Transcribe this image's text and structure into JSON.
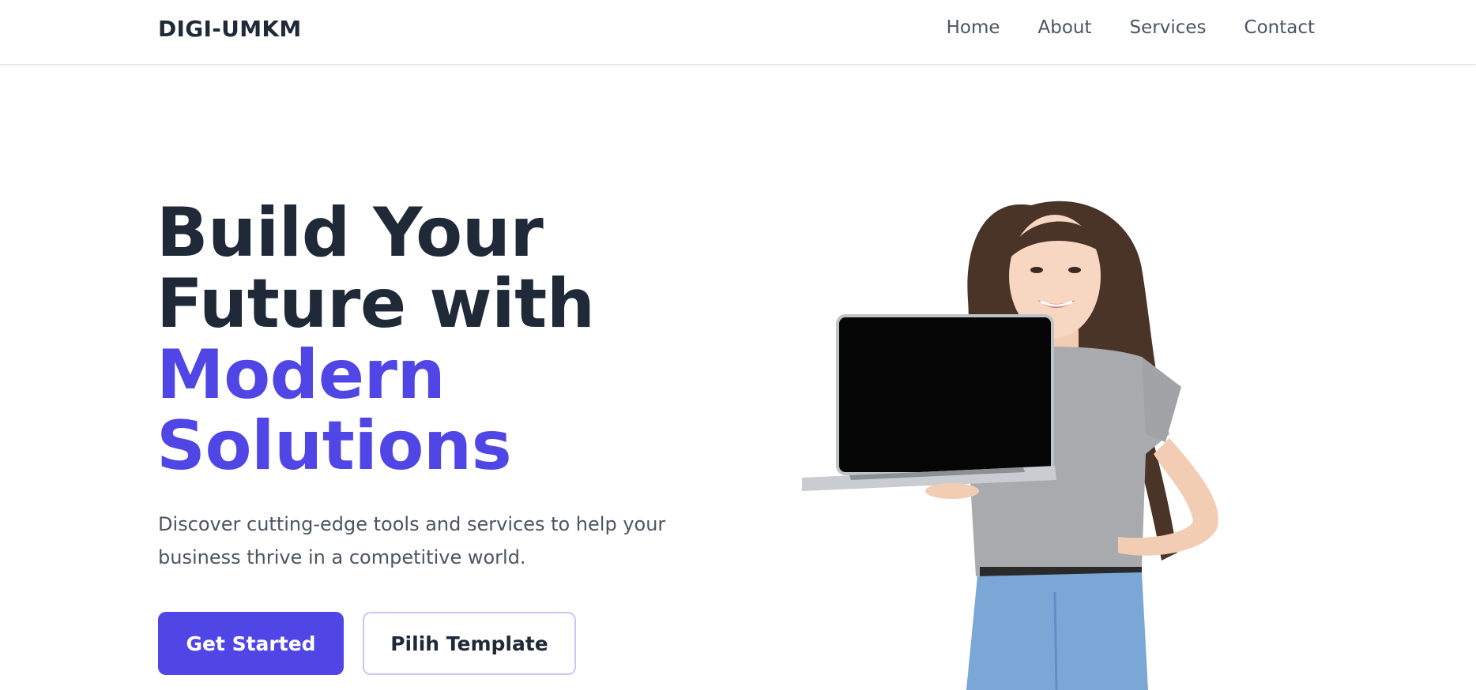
{
  "nav": {
    "brand": "DIGI-UMKM",
    "links": [
      "Home",
      "About",
      "Services",
      "Contact"
    ]
  },
  "hero": {
    "heading_line1": "Build Your",
    "heading_line2": "Future with",
    "heading_accent_line1": "Modern",
    "heading_accent_line2": "Solutions",
    "subtitle": "Discover cutting-edge tools and services to help your business thrive in a competitive world.",
    "primary_button": "Get Started",
    "secondary_button": "Pilih Template"
  },
  "colors": {
    "accent": "#4f46e5",
    "text_dark": "#1f2937",
    "text_muted": "#4b5563"
  },
  "icons": {
    "hero_image": "woman-holding-laptop-illustration"
  }
}
